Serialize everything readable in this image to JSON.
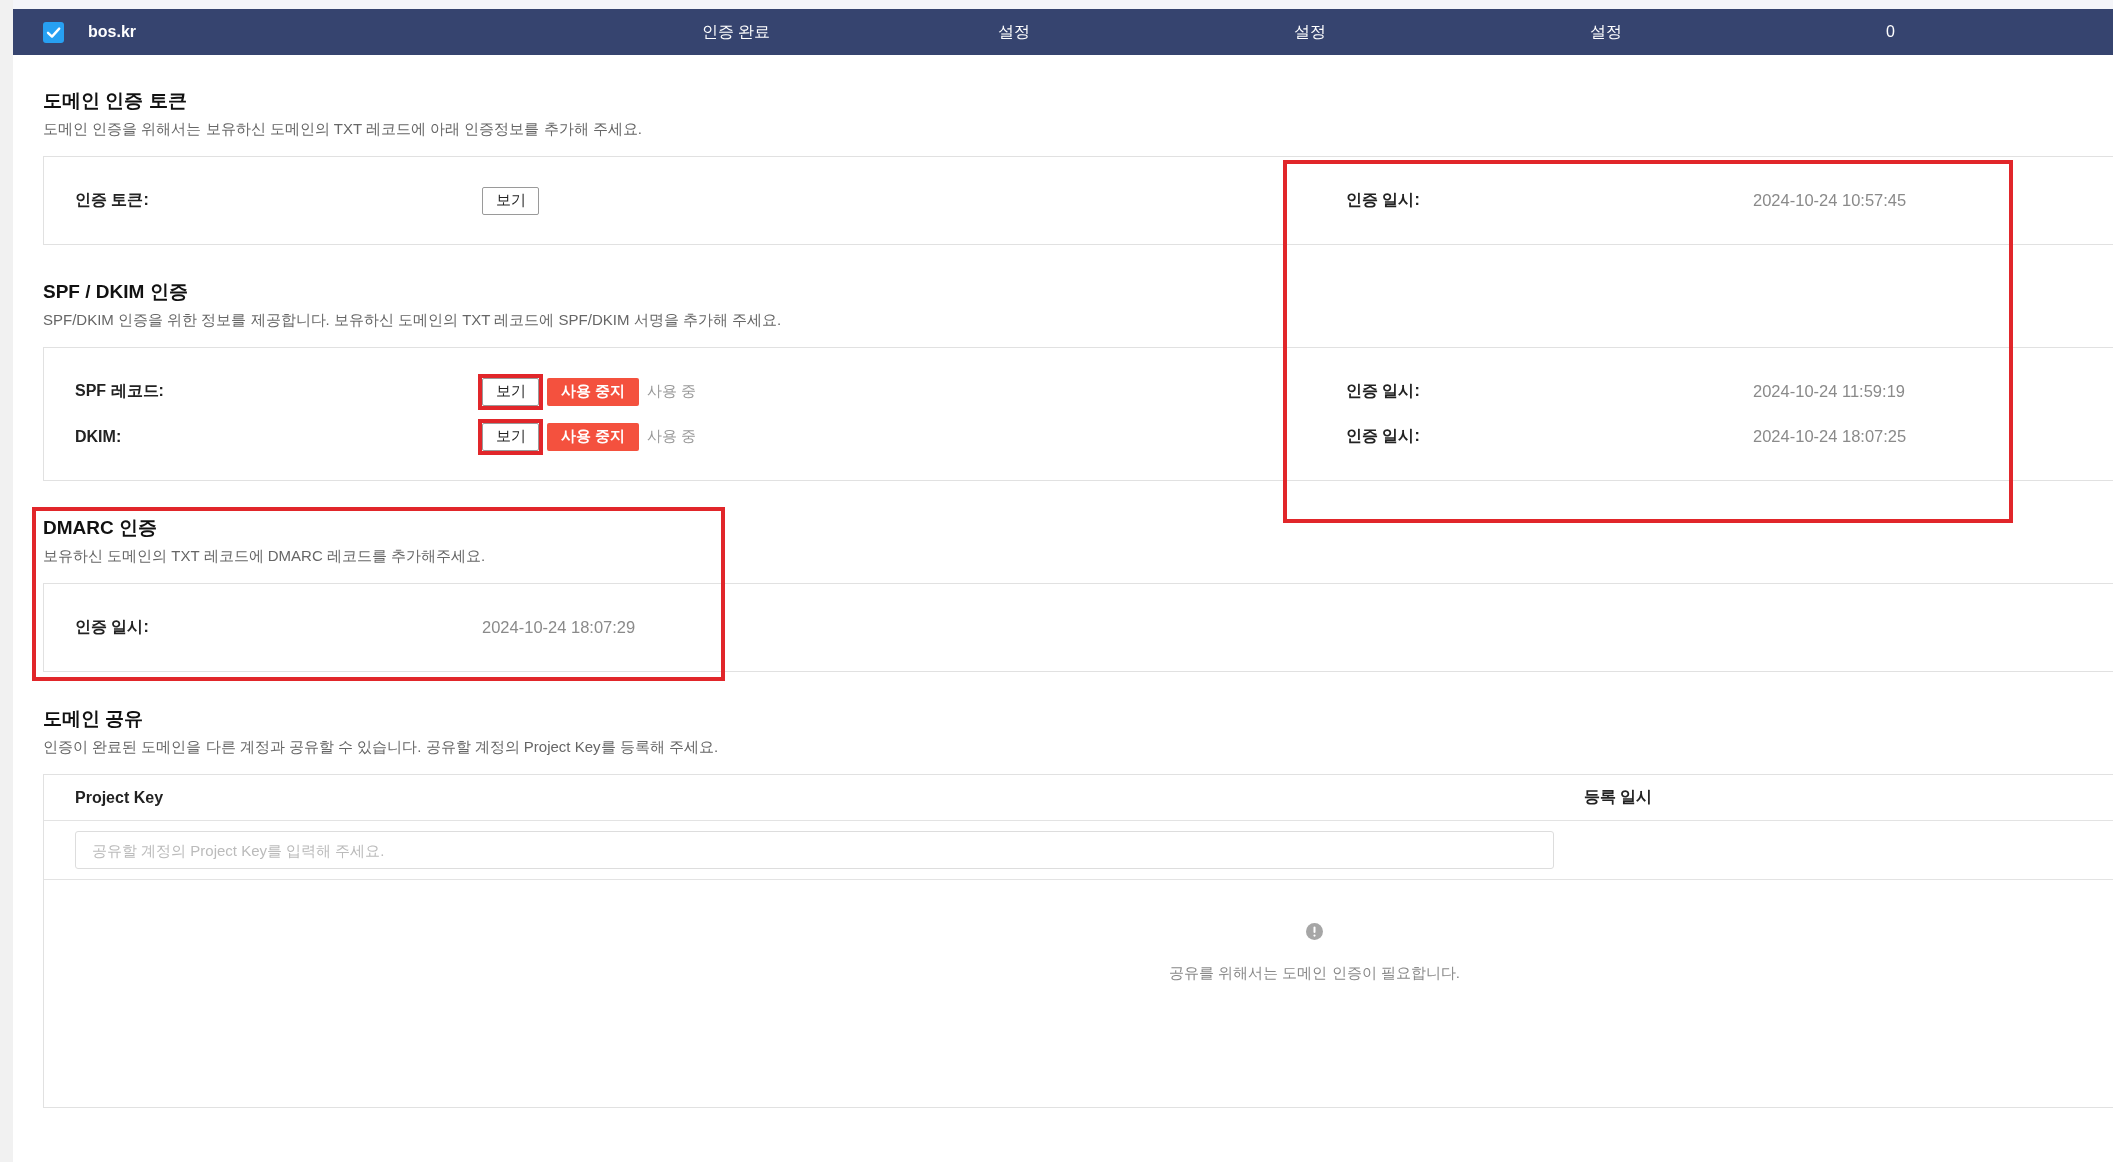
{
  "domain_row": {
    "checked": true,
    "domain": "bos.kr",
    "cells": [
      "인증 완료",
      "설정",
      "설정",
      "설정",
      "0"
    ]
  },
  "date_column_highlighted": true,
  "sections": [
    {
      "title": "도메인 인증 토큰",
      "description": "도메인 인증을 위해서는 보유하신 도메인의 TXT 레코드에 아래 인증정보를 추가해 주세요.",
      "highlighted": false,
      "rows": [
        {
          "label": "인증 토큰:",
          "view_button": {
            "label": "보기",
            "highlighted": false
          },
          "date_label": "인증 일시:",
          "date": "2024-10-24 10:57:45"
        }
      ]
    },
    {
      "title": "SPF / DKIM 인증",
      "description": "SPF/DKIM 인증을 위한 정보를 제공합니다. 보유하신 도메인의 TXT 레코드에 SPF/DKIM 서명을 추가해 주세요.",
      "highlighted": false,
      "rows": [
        {
          "label": "SPF 레코드:",
          "view_button": {
            "label": "보기",
            "highlighted": true
          },
          "disable_button": "사용 중지",
          "status": "사용 중",
          "date_label": "인증 일시:",
          "date": "2024-10-24 11:59:19"
        },
        {
          "label": "DKIM:",
          "view_button": {
            "label": "보기",
            "highlighted": true
          },
          "disable_button": "사용 중지",
          "status": "사용 중",
          "date_label": "인증 일시:",
          "date": "2024-10-24 18:07:25"
        }
      ]
    },
    {
      "title": "DMARC 인증",
      "description": "보유하신 도메인의 TXT 레코드에 DMARC 레코드를 추가해주세요.",
      "highlighted": true,
      "rows": [
        {
          "label": "인증 일시:",
          "value": "2024-10-24 18:07:29"
        }
      ]
    }
  ],
  "sharing": {
    "title": "도메인 공유",
    "description": "인증이 완료된 도메인을 다른 계정과 공유할 수 있습니다. 공유할 계정의 Project Key를 등록해 주세요.",
    "columns": [
      "Project Key",
      "등록 일시"
    ],
    "input": {
      "placeholder": "공유할 계정의 Project Key를 입력해 주세요."
    },
    "empty_message": "공유를 위해서는 도메인 인증이 필요합니다."
  }
}
